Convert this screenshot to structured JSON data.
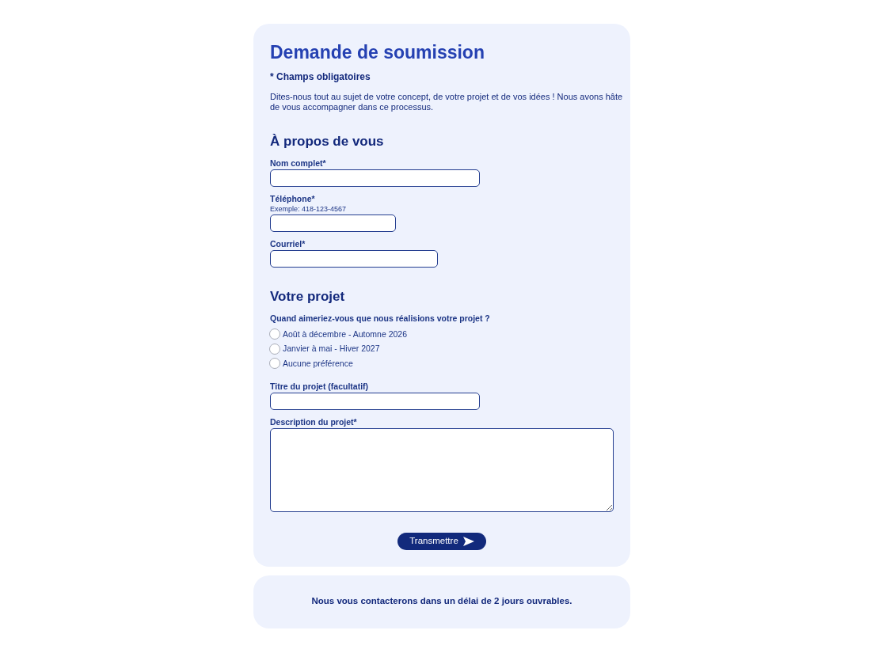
{
  "form": {
    "title": "Demande de soumission",
    "required_note": "* Champs obligatoires",
    "intro": "Dites-nous tout au sujet de votre concept, de votre projet et de vos idées ! Nous avons hâte de vous accompagner dans ce processus.",
    "sections": [
      {
        "heading": "À propos de vous",
        "fields": [
          {
            "kind": "text",
            "label": "Nom complet*"
          },
          {
            "kind": "tel",
            "label": "Téléphone*",
            "help": "Exemple: 418-123-4567"
          },
          {
            "kind": "email",
            "label": "Courriel*"
          }
        ]
      },
      {
        "heading": "Votre projet",
        "fields": [
          {
            "kind": "radio_group",
            "label": "Quand aimeriez-vous que nous réalisions votre projet ?",
            "options": [
              {
                "label": "Août à décembre - Automne 2026",
                "selected": false
              },
              {
                "label": "Janvier à mai - Hiver 2027",
                "selected": false
              },
              {
                "label": "Aucune préférence",
                "selected": false
              }
            ]
          },
          {
            "kind": "text",
            "label": "Titre du projet (facultatif)"
          },
          {
            "kind": "textarea",
            "label": "Description du projet*"
          }
        ]
      }
    ],
    "submit_button": {
      "label": "Transmettre"
    }
  },
  "footer_note": "Nous vous contacterons dans un délai de 2 jours ouvrables."
}
